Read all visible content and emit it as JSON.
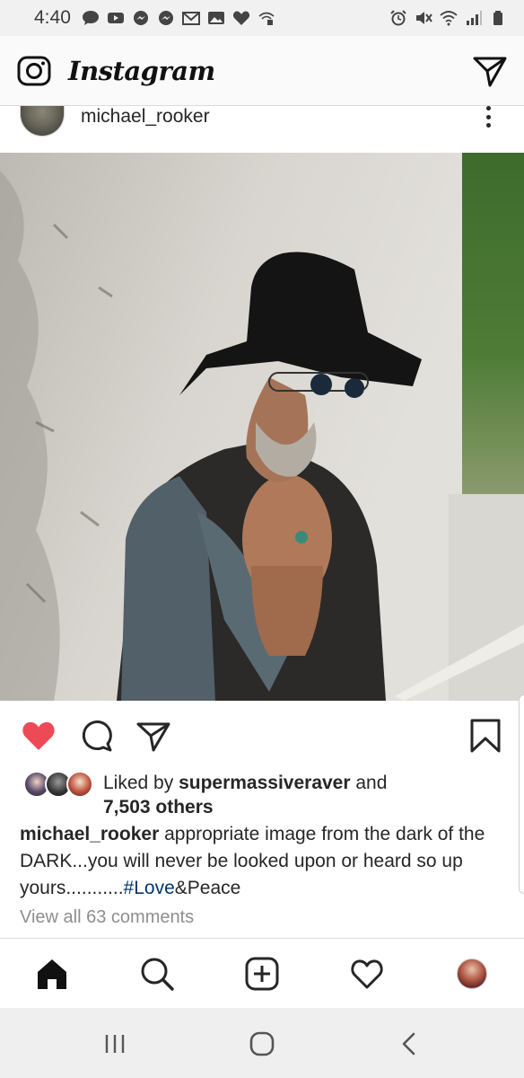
{
  "status_bar": {
    "time": "4:40",
    "left_icons": [
      "messaging-icon",
      "youtube-icon",
      "messenger-icon",
      "messenger-icon",
      "gmail-icon",
      "gallery-icon",
      "heart-icon",
      "wifi-calling-icon"
    ],
    "right_icons": [
      "alarm-icon",
      "mute-icon",
      "wifi-icon",
      "signal-icon",
      "battery-icon"
    ]
  },
  "header": {
    "logo_text": "Instagram",
    "camera_icon": "camera-icon",
    "direct_icon": "paper-plane-icon"
  },
  "post": {
    "username": "michael_rooker",
    "more_icon": "more-vertical-icon",
    "liked_by_prefix": "Liked by ",
    "liked_by_user": "supermassiveraver",
    "liked_by_and": " and",
    "liked_by_others": "7,503 others",
    "caption_user": "michael_rooker",
    "caption_text": " appropriate image from the dark of the DARK...you will never be looked upon or heard so up yours...........",
    "hashtag": "#Love",
    "caption_tail": "&Peace",
    "view_comments": "View all 63 comments",
    "like_color": "#ed4956"
  },
  "actions": [
    "heart-filled-icon",
    "comment-icon",
    "share-icon",
    "bookmark-icon"
  ],
  "bottom_nav": [
    "home-icon",
    "search-icon",
    "add-post-icon",
    "activity-heart-icon",
    "profile-avatar"
  ],
  "android_nav": [
    "recents-icon",
    "home-circle-icon",
    "back-icon"
  ]
}
